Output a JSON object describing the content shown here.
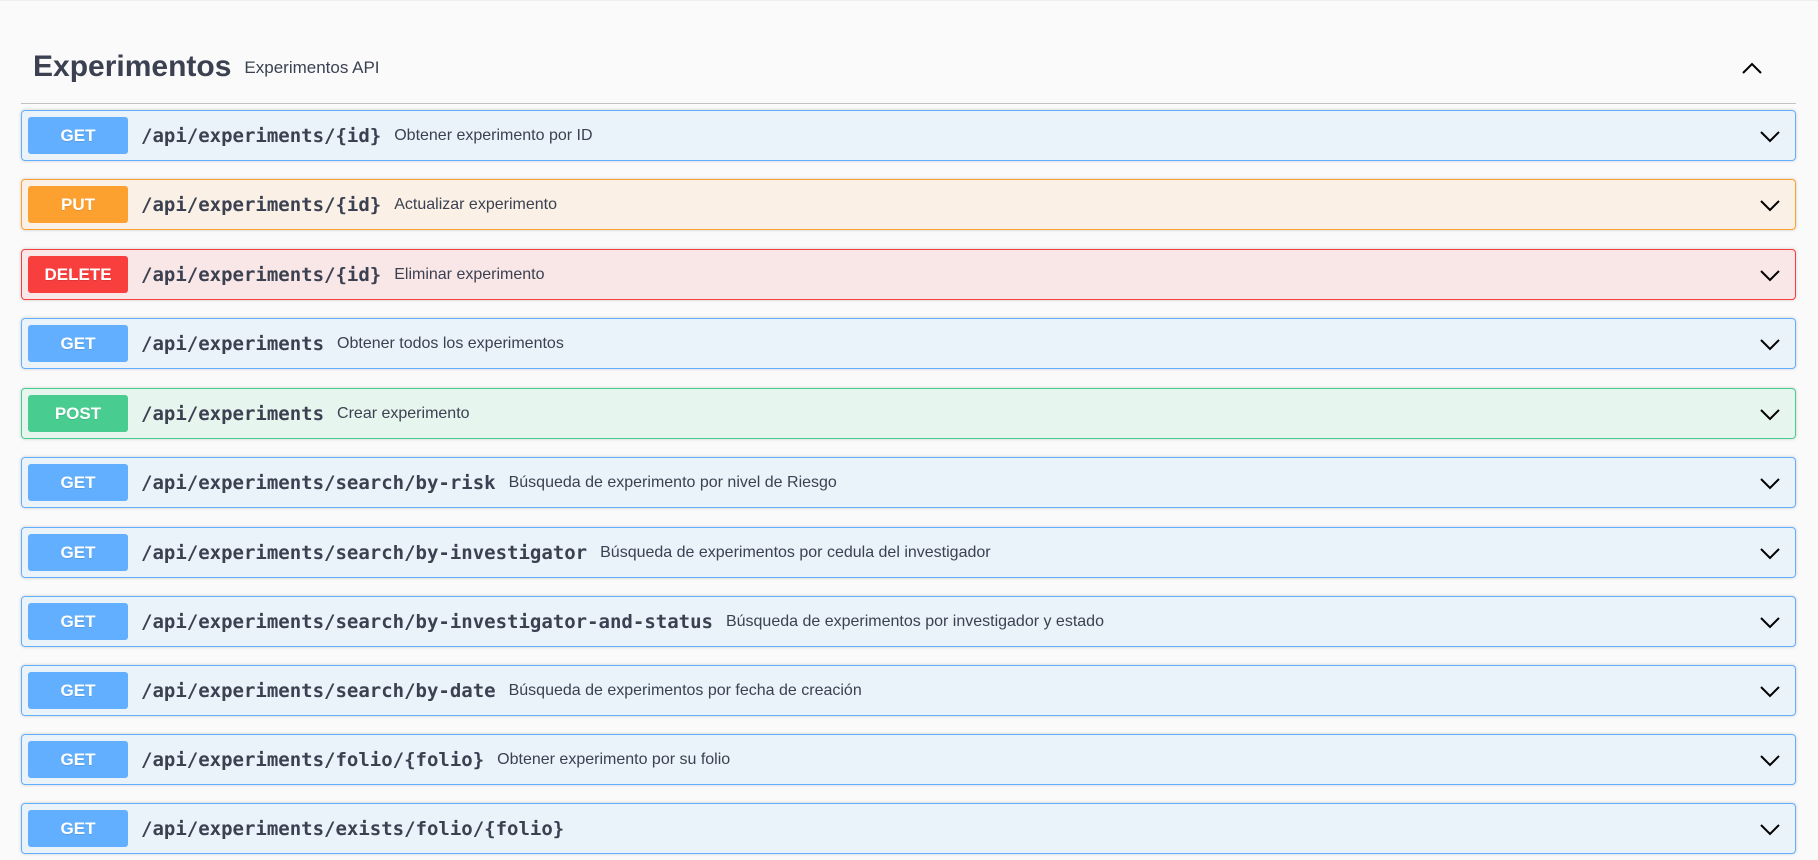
{
  "tag": {
    "title": "Experimentos",
    "description": "Experimentos API"
  },
  "colors": {
    "get": "#61affe",
    "put": "#fca130",
    "delete": "#f93e3e",
    "post": "#49cc90"
  },
  "operations": [
    {
      "method": "GET",
      "path": "/api/experiments/{id}",
      "summary": "Obtener experimento por ID"
    },
    {
      "method": "PUT",
      "path": "/api/experiments/{id}",
      "summary": "Actualizar experimento"
    },
    {
      "method": "DELETE",
      "path": "/api/experiments/{id}",
      "summary": "Eliminar experimento"
    },
    {
      "method": "GET",
      "path": "/api/experiments",
      "summary": "Obtener todos los experimentos"
    },
    {
      "method": "POST",
      "path": "/api/experiments",
      "summary": "Crear experimento"
    },
    {
      "method": "GET",
      "path": "/api/experiments/search/by-risk",
      "summary": "Búsqueda de experimento por nivel de Riesgo"
    },
    {
      "method": "GET",
      "path": "/api/experiments/search/by-investigator",
      "summary": "Búsqueda de experimentos por cedula del investigador"
    },
    {
      "method": "GET",
      "path": "/api/experiments/search/by-investigator-and-status",
      "summary": "Búsqueda de experimentos por investigador y estado"
    },
    {
      "method": "GET",
      "path": "/api/experiments/search/by-date",
      "summary": "Búsqueda de experimentos por fecha de creación"
    },
    {
      "method": "GET",
      "path": "/api/experiments/folio/{folio}",
      "summary": "Obtener experimento por su folio"
    },
    {
      "method": "GET",
      "path": "/api/experiments/exists/folio/{folio}",
      "summary": ""
    }
  ]
}
